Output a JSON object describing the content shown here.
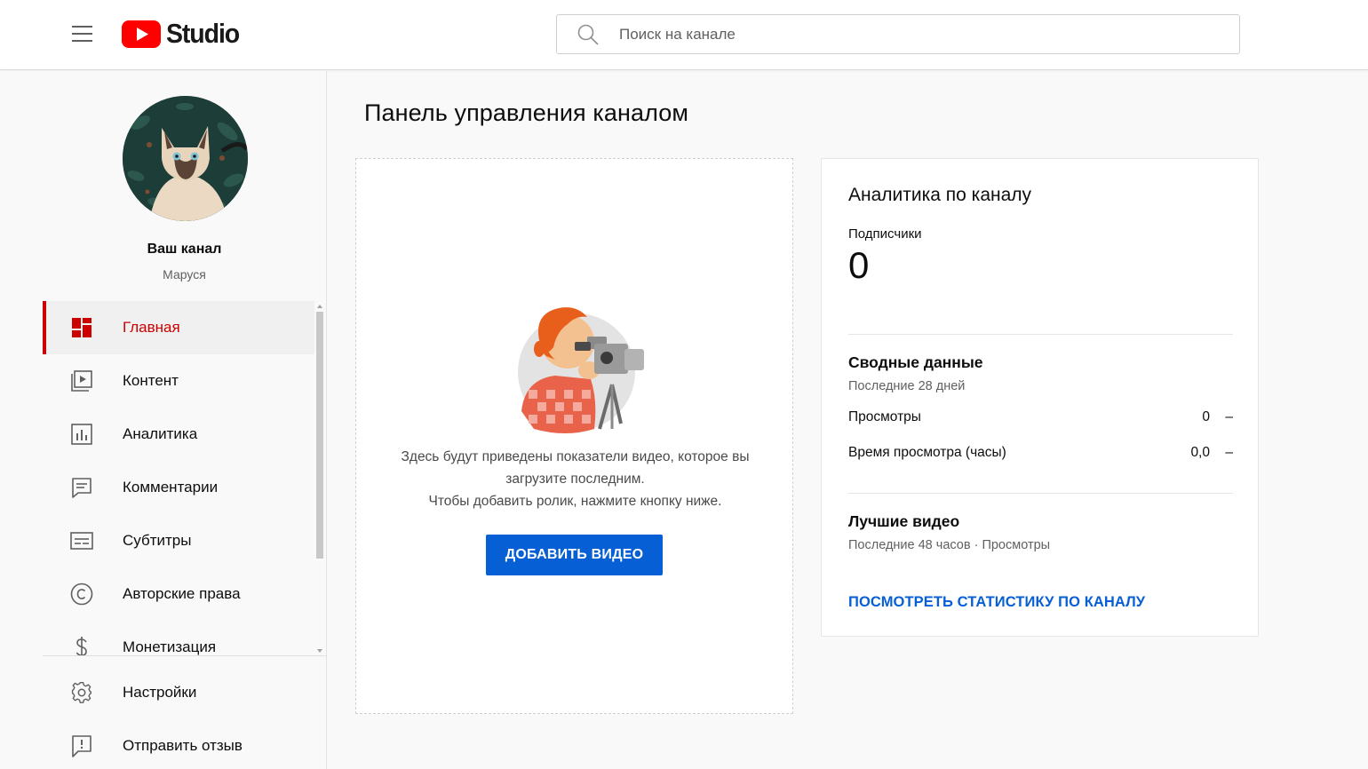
{
  "header": {
    "logo_text": "Studio",
    "search_placeholder": "Поиск на канале"
  },
  "sidebar": {
    "channel_name": "Ваш канал",
    "channel_owner": "Маруся",
    "items": [
      {
        "label": "Главная",
        "icon": "dashboard-icon",
        "active": true
      },
      {
        "label": "Контент",
        "icon": "video-content-icon",
        "active": false
      },
      {
        "label": "Аналитика",
        "icon": "analytics-icon",
        "active": false
      },
      {
        "label": "Комментарии",
        "icon": "comments-icon",
        "active": false
      },
      {
        "label": "Субтитры",
        "icon": "subtitles-icon",
        "active": false
      },
      {
        "label": "Авторские права",
        "icon": "copyright-icon",
        "active": false
      },
      {
        "label": "Монетизация",
        "icon": "monetization-icon",
        "active": false
      }
    ],
    "bottom_items": [
      {
        "label": "Настройки",
        "icon": "gear-icon"
      },
      {
        "label": "Отправить отзыв",
        "icon": "feedback-icon"
      }
    ]
  },
  "main": {
    "title": "Панель управления каналом",
    "upload_card": {
      "text_line1": "Здесь будут приведены показатели видео, которое вы",
      "text_line2": "загрузите последним.",
      "text_line3": "Чтобы добавить ролик, нажмите кнопку ниже.",
      "button": "ДОБАВИТЬ ВИДЕО"
    },
    "analytics": {
      "title": "Аналитика по каналу",
      "subscribers_label": "Подписчики",
      "subscribers_value": "0",
      "summary_title": "Сводные данные",
      "summary_period": "Последние 28 дней",
      "rows": [
        {
          "label": "Просмотры",
          "value": "0",
          "delta": "–"
        },
        {
          "label": "Время просмотра (часы)",
          "value": "0,0",
          "delta": "–"
        }
      ],
      "top_title": "Лучшие видео",
      "top_period": "Последние 48 часов · Просмотры",
      "link": "ПОСМОТРЕТЬ СТАТИСТИКУ ПО КАНАЛУ"
    }
  },
  "colors": {
    "brand_red": "#ff0000",
    "active_red": "#cc0000",
    "primary_blue": "#065fd4"
  }
}
